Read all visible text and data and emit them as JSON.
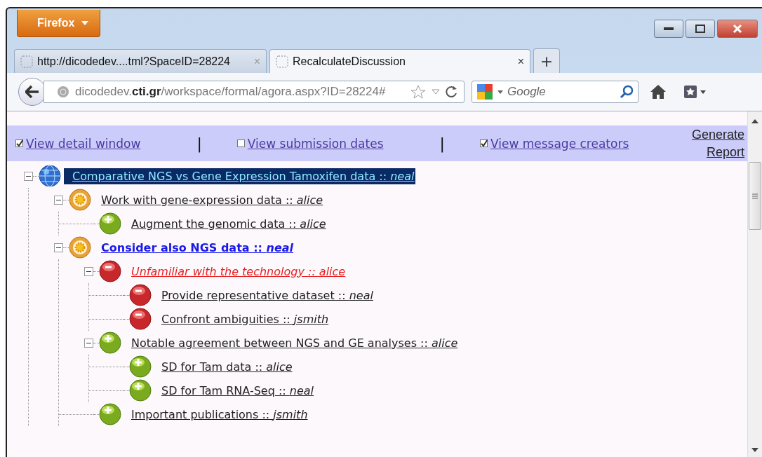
{
  "app_button": {
    "label": "Firefox"
  },
  "tabs": [
    {
      "title": "http://dicodedev....tml?SpaceID=28224",
      "close": "×",
      "selected": false
    },
    {
      "title": "RecalculateDiscussion",
      "close": "×",
      "selected": true
    }
  ],
  "new_tab": "+",
  "address_bar": {
    "url": "dicodedev.**cti.gr**/workspace/formal/agora.aspx?ID=28224#"
  },
  "search": {
    "placeholder": "Google"
  },
  "view_options": [
    {
      "label": "View detail window",
      "checked": true
    },
    {
      "label": "View submission dates",
      "checked": false
    },
    {
      "label": "View message creators",
      "checked": true
    }
  ],
  "separator": "|",
  "report_link": "Generate Report",
  "tree": [
    {
      "kind": "issue",
      "selected": true,
      "active": false,
      "flagged": false,
      "text": "Comparative NGS vs Gene Expression Tamoxifen data :: *neal*",
      "expanded": true,
      "children": [
        {
          "kind": "position",
          "selected": false,
          "active": false,
          "flagged": false,
          "text": "Work with gene-expression data :: *alice*",
          "expanded": true,
          "children": [
            {
              "kind": "pro",
              "selected": false,
              "active": false,
              "flagged": false,
              "text": "Augment the genomic data :: *alice*"
            }
          ]
        },
        {
          "kind": "position",
          "selected": false,
          "active": true,
          "flagged": false,
          "text": "Consider also NGS data :: *neal*",
          "expanded": true,
          "children": [
            {
              "kind": "con",
              "selected": false,
              "active": false,
              "flagged": true,
              "text": "Unfamiliar with the technology :: alice",
              "expanded": true,
              "children": [
                {
                  "kind": "con",
                  "selected": false,
                  "active": false,
                  "flagged": false,
                  "text": "Provide representative dataset :: *neal*"
                },
                {
                  "kind": "con",
                  "selected": false,
                  "active": false,
                  "flagged": false,
                  "text": "Confront ambiguities :: *jsmith*"
                }
              ]
            },
            {
              "kind": "pro",
              "selected": false,
              "active": false,
              "flagged": false,
              "text": "Notable agreement between NGS and GE analyses :: *alice*",
              "expanded": true,
              "children": [
                {
                  "kind": "pro",
                  "selected": false,
                  "active": false,
                  "flagged": false,
                  "text": "SD for Tam data :: *alice*"
                },
                {
                  "kind": "pro",
                  "selected": false,
                  "active": false,
                  "flagged": false,
                  "text": "SD for Tam RNA-Seq :: *neal*"
                }
              ]
            },
            {
              "kind": "pro",
              "selected": false,
              "active": false,
              "flagged": false,
              "text": "Important publications :: *jsmith*"
            }
          ]
        }
      ]
    }
  ]
}
